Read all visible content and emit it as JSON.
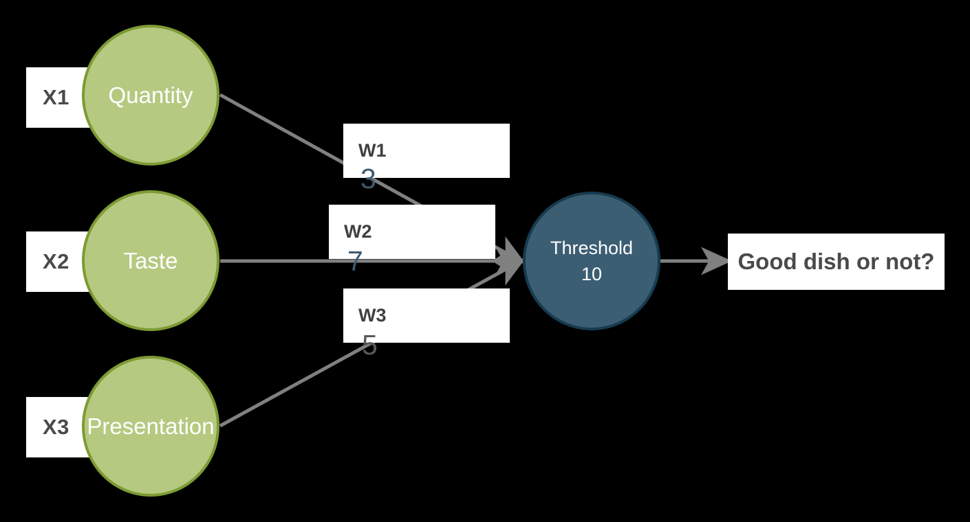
{
  "diagram": {
    "title": "Perceptron decision diagram",
    "background_color": "#000000",
    "colors": {
      "input_node_fill": "#b5c980",
      "input_node_border": "#7d9b33",
      "threshold_fill": "#3c5e73",
      "threshold_border": "#173b4f",
      "edge": "#808080",
      "box_fill": "#ffffff",
      "box_text": "#4a4a4a",
      "weight_value": "#3d5a70"
    },
    "inputs": [
      {
        "id": "X1",
        "label": "X1",
        "node_label": "Quantity"
      },
      {
        "id": "X2",
        "label": "X2",
        "node_label": "Taste"
      },
      {
        "id": "X3",
        "label": "X3",
        "node_label": "Presentation"
      }
    ],
    "weights": [
      {
        "name": "W1",
        "value": "3"
      },
      {
        "name": "W2",
        "value": "7"
      },
      {
        "name": "W3",
        "value": "5"
      }
    ],
    "threshold": {
      "label": "Threshold",
      "value": "10"
    },
    "output": {
      "label": "Good dish or not?"
    }
  }
}
